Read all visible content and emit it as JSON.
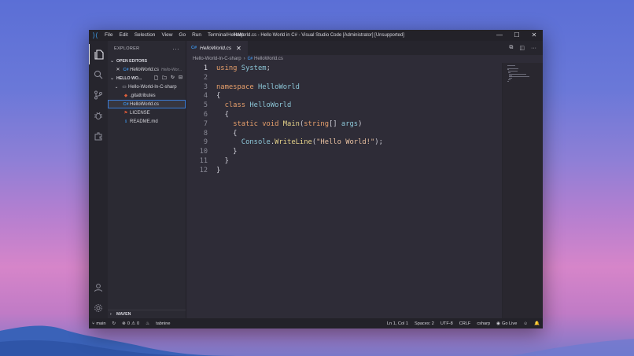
{
  "window": {
    "title": "HelloWorld.cs - Hello World in C# - Visual Studio Code [Administrator] [Unsupported]",
    "menu": [
      "File",
      "Edit",
      "Selection",
      "View",
      "Go",
      "Run",
      "Terminal",
      "Help"
    ]
  },
  "sidebar": {
    "header": "EXPLORER",
    "open_editors_label": "OPEN EDITORS",
    "open_editor": {
      "name": "HelloWorld.cs",
      "desc": "Hello-Wor..."
    },
    "workspace_label": "HELLO WO...",
    "folder": "Hello-World-In-C-sharp",
    "files": [
      {
        "name": ".gitattributes",
        "icon": "◆",
        "color": "#e0603a"
      },
      {
        "name": "HelloWorld.cs",
        "icon": "C#",
        "color": "#3d8fe0"
      },
      {
        "name": "LICENSE",
        "icon": "⚑",
        "color": "#e05a3a"
      },
      {
        "name": "README.md",
        "icon": "ℹ",
        "color": "#3d8fe0"
      }
    ],
    "maven_label": "MAVEN"
  },
  "editor": {
    "tab": "HelloWorld.cs",
    "breadcrumb": [
      "Hello-World-In-C-sharp",
      "HelloWorld.cs"
    ],
    "line_numbers": [
      "1",
      "2",
      "3",
      "4",
      "5",
      "6",
      "7",
      "8",
      "9",
      "10",
      "11",
      "12"
    ]
  },
  "status": {
    "branch": "main",
    "problems": "0",
    "warnings": "0",
    "tabnine": "tabnine",
    "position": "Ln 1, Col 1",
    "spaces": "Spaces: 2",
    "encoding": "UTF-8",
    "eol": "CRLF",
    "language": "csharp",
    "golive": "Go Live"
  }
}
